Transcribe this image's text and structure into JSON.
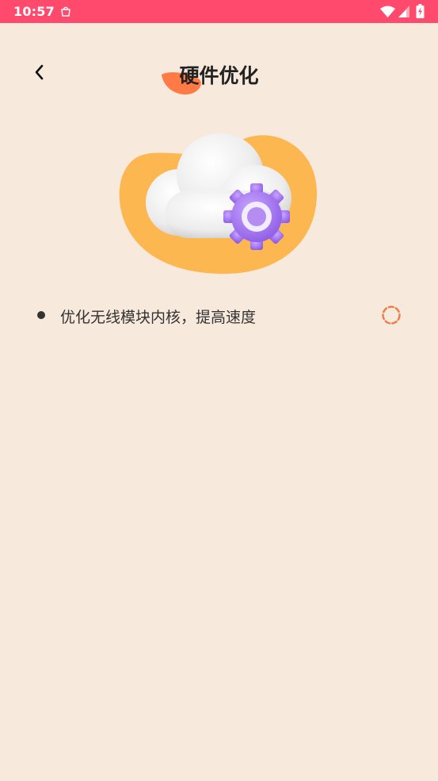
{
  "status_bar": {
    "time": "10:57",
    "icons": [
      "notification-bag-icon",
      "wifi-icon",
      "cell-signal-icon",
      "battery-charging-icon"
    ],
    "color": "#FF4A6E"
  },
  "header": {
    "back_icon": "chevron-left-icon",
    "title": "硬件优化"
  },
  "hero": {
    "illustration": "cloud-gear-illustration"
  },
  "tasks": [
    {
      "label": "优化无线模块内核，提高速度",
      "status": "loading"
    }
  ],
  "colors": {
    "background": "#F7E9DC",
    "accent_orange": "#FF7A45",
    "blob_yellow": "#FDB750",
    "gear_purple": "#B48CF2",
    "spinner": "#F07C4A"
  }
}
